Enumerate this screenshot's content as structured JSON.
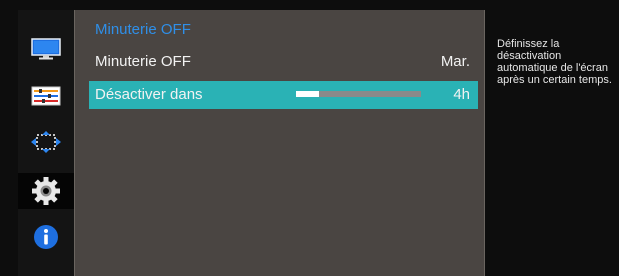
{
  "sidebar": {
    "items": [
      {
        "icon": "monitor-icon",
        "active": false
      },
      {
        "icon": "adjustment-sliders-icon",
        "active": false
      },
      {
        "icon": "size-position-icon",
        "active": false
      },
      {
        "icon": "settings-gear-icon",
        "active": true
      },
      {
        "icon": "info-icon",
        "active": false
      }
    ]
  },
  "menu": {
    "title": "Minuterie OFF",
    "rows": [
      {
        "label": "Minuterie OFF",
        "value": "Mar."
      },
      {
        "label": "Désactiver dans",
        "value": "4h",
        "slider_level": 0.18
      }
    ]
  },
  "help": {
    "text": "Définissez la désactivation automatique de l'écran après un certain temps."
  },
  "colors": {
    "title": "#2f8fe8",
    "highlight": "#2ab2b5",
    "panel": "#4a4542",
    "background": "#0d0d0d"
  }
}
